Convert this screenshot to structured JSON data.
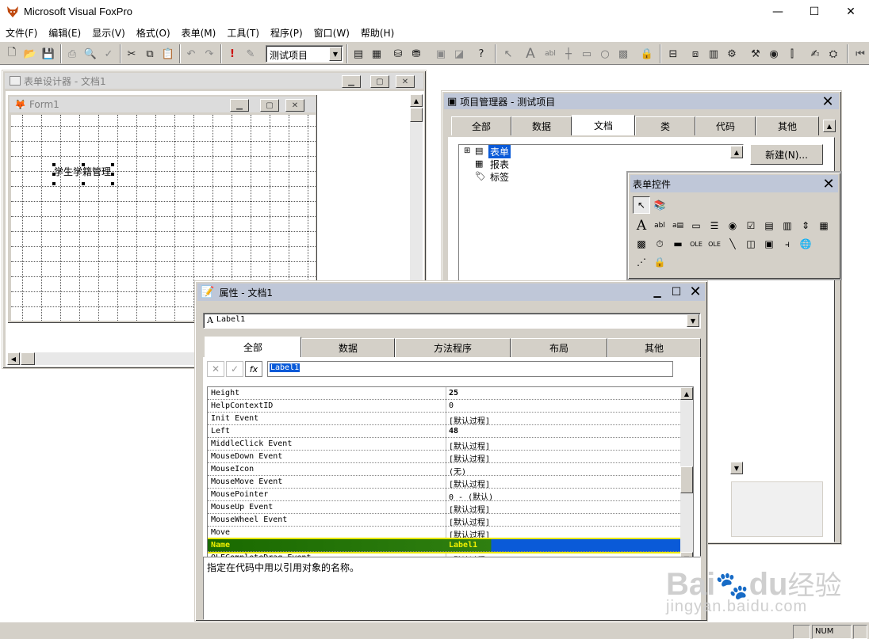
{
  "app": {
    "title": "Microsoft Visual FoxPro",
    "window_controls": {
      "minimize": "—",
      "maximize": "☐",
      "close": "✕"
    }
  },
  "menu": [
    "文件(F)",
    "编辑(E)",
    "显示(V)",
    "格式(O)",
    "表单(M)",
    "工具(T)",
    "程序(P)",
    "窗口(W)",
    "帮助(H)"
  ],
  "toolbar": {
    "project_combo": "测试项目"
  },
  "form_designer": {
    "title": "表单设计器 - 文档1",
    "form_title": "Form1",
    "label_caption": "学生学籍管理"
  },
  "project_manager": {
    "title": "项目管理器 - 测试项目",
    "tabs": [
      "全部",
      "数据",
      "文档",
      "类",
      "代码",
      "其他"
    ],
    "selected_tab": "文档",
    "tree": [
      "表单",
      "报表",
      "标签"
    ],
    "new_button": "新建(N)..."
  },
  "form_controls": {
    "title": "表单控件"
  },
  "properties": {
    "title": "属性 - 文档1",
    "object_combo": "Label1",
    "tabs": [
      "全部",
      "数据",
      "方法程序",
      "布局",
      "其他"
    ],
    "edit_value": "Label1",
    "rows": [
      {
        "name": "Height",
        "value": "25",
        "bold": true
      },
      {
        "name": "HelpContextID",
        "value": "0",
        "bold": false
      },
      {
        "name": "Init Event",
        "value": "[默认过程]",
        "bold": false
      },
      {
        "name": "Left",
        "value": "48",
        "bold": true
      },
      {
        "name": "MiddleClick Event",
        "value": "[默认过程]",
        "bold": false
      },
      {
        "name": "MouseDown Event",
        "value": "[默认过程]",
        "bold": false
      },
      {
        "name": "MouseIcon",
        "value": "(无)",
        "bold": false
      },
      {
        "name": "MouseMove Event",
        "value": "[默认过程]",
        "bold": false
      },
      {
        "name": "MousePointer",
        "value": "0 - (默认)",
        "bold": false
      },
      {
        "name": "MouseUp Event",
        "value": "[默认过程]",
        "bold": false
      },
      {
        "name": "MouseWheel Event",
        "value": "[默认过程]",
        "bold": false
      },
      {
        "name": "Move",
        "value": "[默认过程]",
        "bold": false
      },
      {
        "name": "Name",
        "value": "Label1",
        "bold": true
      },
      {
        "name": "OLECompleteDrag Event",
        "value": "[默认过程]",
        "bold": false
      }
    ],
    "selected_row": "Name",
    "description": "指定在代码中用以引用对象的名称。"
  },
  "statusbar": {
    "num": "NUM"
  },
  "watermark": {
    "brand": "Bai",
    "paw": "🐾",
    "suffix": "du",
    "chinese": "经验",
    "url": "jingyan.baidu.com"
  }
}
